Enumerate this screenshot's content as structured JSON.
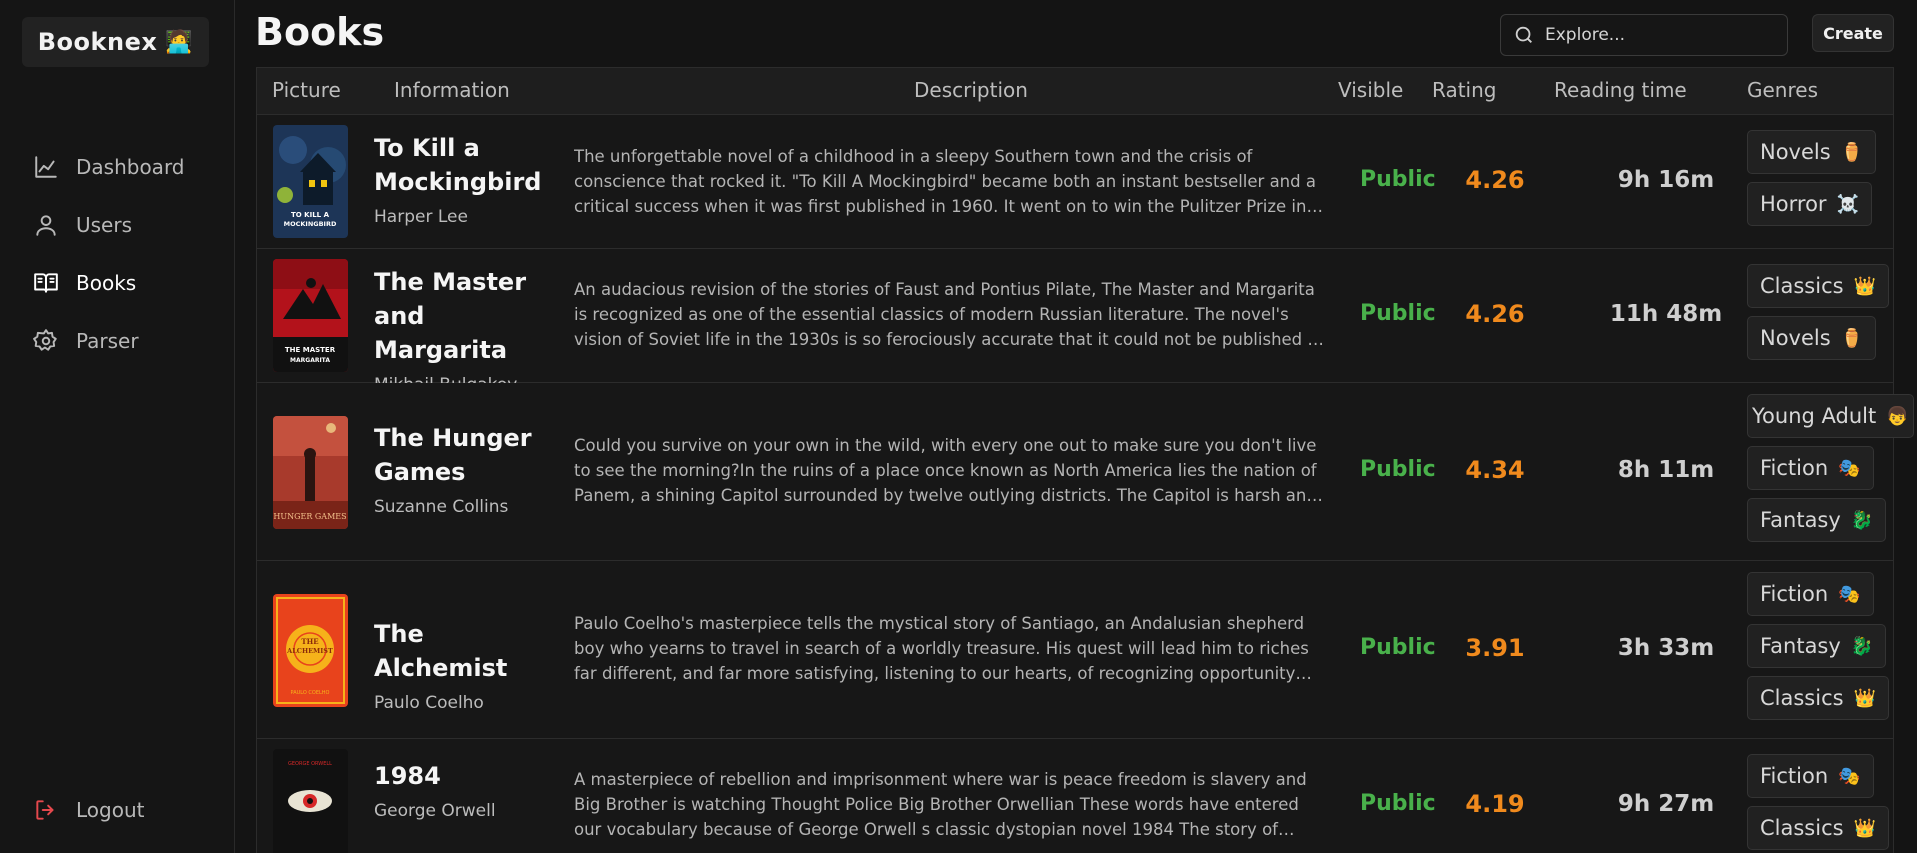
{
  "brand": {
    "name": "Booknex",
    "emoji": "🧑‍💻"
  },
  "nav": {
    "items": [
      {
        "label": "Dashboard",
        "icon": "chart-icon"
      },
      {
        "label": "Users",
        "icon": "user-icon"
      },
      {
        "label": "Books",
        "icon": "book-icon"
      },
      {
        "label": "Parser",
        "icon": "gear-icon"
      }
    ],
    "active": "Books",
    "logout": "Logout"
  },
  "page": {
    "title": "Books"
  },
  "search": {
    "placeholder": "Explore..."
  },
  "toolbar": {
    "create_label": "Create"
  },
  "table": {
    "columns": [
      "Picture",
      "Information",
      "Description",
      "Visible",
      "Rating",
      "Reading time",
      "Genres"
    ],
    "rows": [
      {
        "title": "To Kill a Mockingbird",
        "author": "Harper Lee",
        "description": "The unforgettable novel of a childhood in a sleepy Southern town and the crisis of conscience that rocked it. \"To Kill A Mockingbird\" became both an instant bestseller and a critical success when it was first published in 1960. It went on to win the Pulitzer Prize in 1961 and was later made into an Academy Award-winning film.",
        "visible": "Public",
        "rating": "4.26",
        "reading_time": "9h 16m",
        "genres": [
          {
            "name": "Novels",
            "emoji": "⚱️"
          },
          {
            "name": "Horror",
            "emoji": "☠️"
          }
        ],
        "cover": {
          "bg": "#1d3557",
          "accent": "#f1c40f",
          "text": "TO KILL A MOCKINGBIRD"
        }
      },
      {
        "title": "The Master and Margarita",
        "author": "Mikhail Bulgakov",
        "description": "An audacious revision of the stories of Faust and Pontius Pilate, The Master and Margarita is recognized as one of the essential classics of modern Russian literature. The novel's vision of Soviet life in the 1930s is so ferociously accurate that it could not be published in its author's lifetime.",
        "visible": "Public",
        "rating": "4.26",
        "reading_time": "11h 48m",
        "genres": [
          {
            "name": "Classics",
            "emoji": "👑"
          },
          {
            "name": "Novels",
            "emoji": "⚱️"
          }
        ],
        "cover": {
          "bg": "#b3121b",
          "accent": "#111111",
          "text": "THE MASTER & MARGARITA"
        }
      },
      {
        "title": "The Hunger Games",
        "author": "Suzanne Collins",
        "description": "Could you survive on your own in the wild, with every one out to make sure you don't live to see the morning?In the ruins of a place once known as North America lies the nation of Panem, a shining Capitol surrounded by twelve outlying districts. The Capitol is harsh and cruel and keeps the districts in line.",
        "visible": "Public",
        "rating": "4.34",
        "reading_time": "8h 11m",
        "genres": [
          {
            "name": "Young Adult",
            "emoji": "👦"
          },
          {
            "name": "Fiction",
            "emoji": "🎭"
          },
          {
            "name": "Fantasy",
            "emoji": "🐉"
          }
        ],
        "cover": {
          "bg": "#a83a2c",
          "accent": "#2b1410",
          "text": "THE HUNGER GAMES"
        }
      },
      {
        "title": "The Alchemist",
        "author": "Paulo Coelho",
        "description": "Paulo Coelho's masterpiece tells the mystical story of Santiago, an Andalusian shepherd boy who yearns to travel in search of a worldly treasure. His quest will lead him to riches far different, and far more satisfying, listening to our hearts, of recognizing opportunity and learning to read the omens strewn along life's path.",
        "visible": "Public",
        "rating": "3.91",
        "reading_time": "3h 33m",
        "genres": [
          {
            "name": "Fiction",
            "emoji": "🎭"
          },
          {
            "name": "Fantasy",
            "emoji": "🐉"
          },
          {
            "name": "Classics",
            "emoji": "👑"
          }
        ],
        "cover": {
          "bg": "#e8431c",
          "accent": "#f6b21a",
          "text": "THE ALCHEMIST"
        }
      },
      {
        "title": "1984",
        "author": "George Orwell",
        "description": "A masterpiece of rebellion and imprisonment where war is peace freedom is slavery and Big Brother is watching Thought Police Big Brother Orwellian These words have entered our vocabulary because of George Orwell s classic dystopian novel 1984 The story of Winston Smith.",
        "visible": "Public",
        "rating": "4.19",
        "reading_time": "9h 27m",
        "genres": [
          {
            "name": "Fiction",
            "emoji": "🎭"
          },
          {
            "name": "Classics",
            "emoji": "👑"
          }
        ],
        "cover": {
          "bg": "#111111",
          "accent": "#d62828",
          "text": "1984"
        }
      }
    ]
  },
  "colors": {
    "public": "#49b14b",
    "rating": "#f08a1d",
    "logout_icon": "#e5484d"
  }
}
